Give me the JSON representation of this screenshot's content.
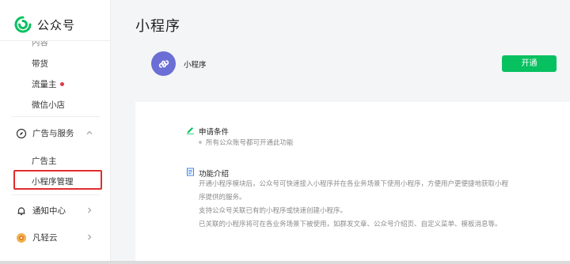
{
  "brand": {
    "name": "公众号",
    "logo_icon": "wechat-official-logo-icon",
    "logo_color": "#07c160"
  },
  "sidebar": {
    "partial_item": "内容",
    "items_top": [
      {
        "label": "带货"
      },
      {
        "label": "流量主",
        "has_dot": true
      },
      {
        "label": "微信小店"
      }
    ],
    "ads_section": {
      "label": "广告与服务",
      "icon": "compass-icon",
      "expanded": true
    },
    "ads_items": [
      {
        "label": "广告主"
      },
      {
        "label": "小程序管理",
        "active": true
      }
    ],
    "notify_section": {
      "label": "通知中心",
      "icon": "bell-icon"
    },
    "fanqingyun_section": {
      "label": "凡轻云",
      "icon": "fanqingyun-icon"
    }
  },
  "main": {
    "title": "小程序",
    "app": {
      "name": "小程序",
      "open_label": "开通",
      "icon": "mini-program-icon"
    },
    "conditions": {
      "title": "申请条件",
      "icon": "pencil-icon",
      "lines": [
        "所有公众账号都可开通此功能"
      ]
    },
    "intro": {
      "title": "功能介绍",
      "icon": "document-icon",
      "lines": [
        "开通小程序模块后，公众号可快速接入小程序并在各业务场景下使用小程序，方便用户更便捷地获取小程",
        "序提供的服务。",
        "支持公众号关联已有的小程序或快速创建小程序。",
        "已关联的小程序将可在各业务场景下被使用，如群发文章、公众号介绍页、自定义菜单、模板消息等。"
      ]
    }
  },
  "colors": {
    "accent": "#07c160",
    "highlight": "#e02d2d",
    "avatar": "#6b6ed4"
  }
}
